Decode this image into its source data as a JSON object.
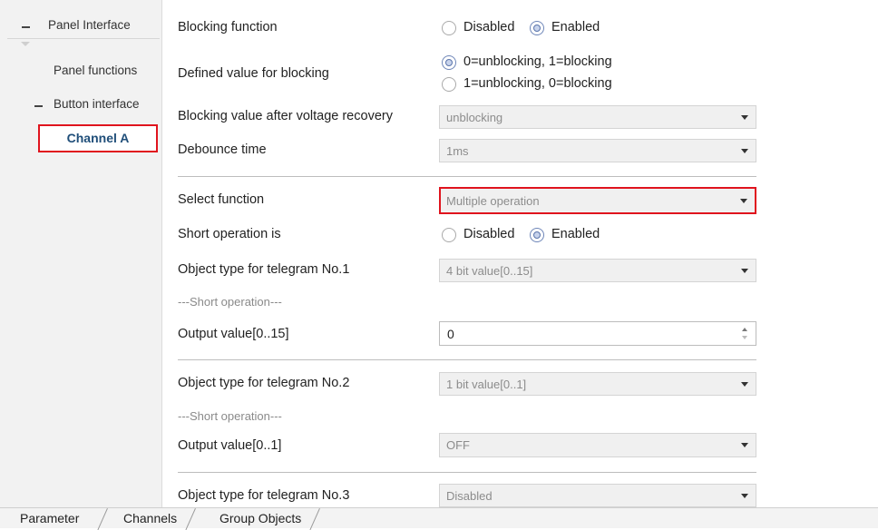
{
  "tree": {
    "root": "Panel Interface",
    "panel_functions": "Panel functions",
    "button_interface": "Button interface",
    "channel_a": "Channel A"
  },
  "params": {
    "blocking_function": {
      "label": "Blocking function",
      "options": [
        "Disabled",
        "Enabled"
      ],
      "selected": "Enabled"
    },
    "defined_value": {
      "label": "Defined value for blocking",
      "options": [
        "0=unblocking, 1=blocking",
        "1=unblocking, 0=blocking"
      ],
      "selected": "0=unblocking, 1=blocking"
    },
    "blocking_after_recovery": {
      "label": "Blocking value after voltage recovery",
      "value": "unblocking"
    },
    "debounce_time": {
      "label": "Debounce time",
      "value": "1ms"
    },
    "select_function": {
      "label": "Select function",
      "value": "Multiple operation"
    },
    "short_operation": {
      "label": "Short operation is",
      "options": [
        "Disabled",
        "Enabled"
      ],
      "selected": "Enabled"
    },
    "telegram1": {
      "label": "Object type for telegram No.1",
      "value": "4 bit value[0..15]",
      "section": "---Short operation---",
      "output_label": "Output value[0..15]",
      "output_value": "0"
    },
    "telegram2": {
      "label": "Object type for telegram No.2",
      "value": "1 bit value[0..1]",
      "section": "---Short operation---",
      "output_label": "Output value[0..1]",
      "output_value": "OFF"
    },
    "telegram3": {
      "label": "Object type for telegram No.3",
      "value": "Disabled"
    }
  },
  "tabs": [
    "Parameter",
    "Channels",
    "Group Objects"
  ],
  "colors": {
    "highlight": "#e0141e",
    "selected_text": "#1f4e79"
  }
}
